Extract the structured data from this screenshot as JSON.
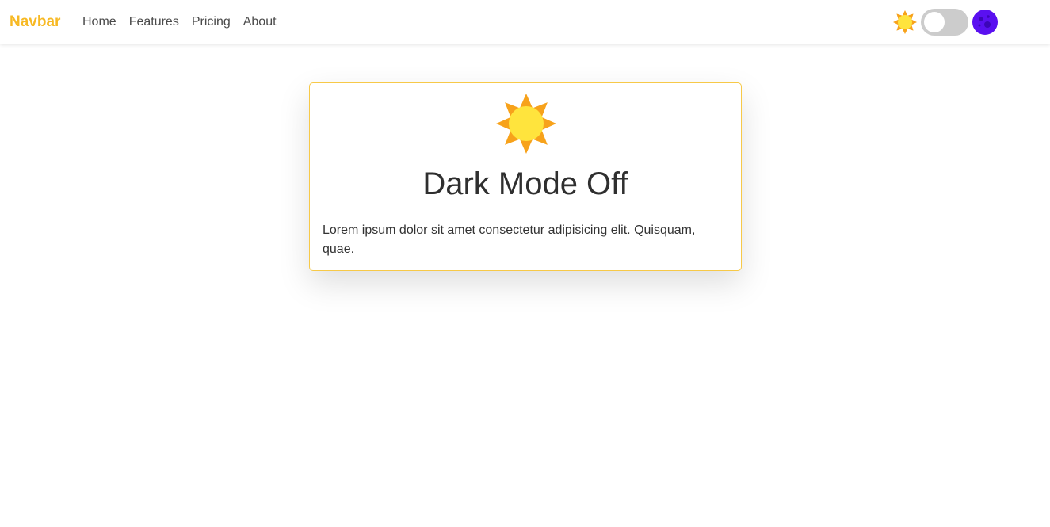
{
  "navbar": {
    "brand": "Navbar",
    "links": [
      "Home",
      "Features",
      "Pricing",
      "About"
    ],
    "theme_toggle": {
      "dark_mode_enabled": false
    }
  },
  "card": {
    "title": "Dark Mode Off",
    "text": "Lorem ipsum dolor sit amet consectetur adipisicing elit. Quisquam, quae."
  },
  "colors": {
    "brand": "#f7b924",
    "sun_outer": "#f7a21b",
    "sun_inner": "#ffe43d",
    "moon": "#5a10f0",
    "card_border": "#f7c948"
  },
  "icons": [
    "sun-icon",
    "moon-icon"
  ]
}
